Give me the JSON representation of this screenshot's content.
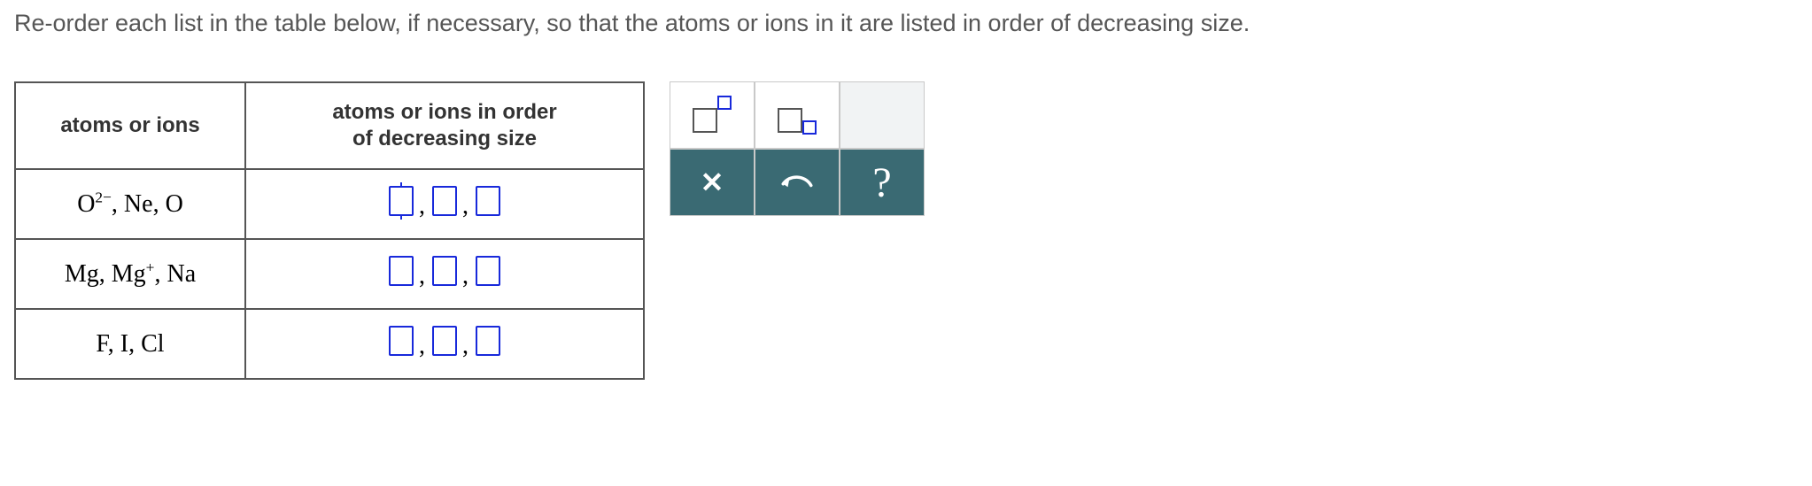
{
  "instruction": "Re-order each list in the table below, if necessary, so that the atoms or ions in it are listed in order of decreasing size.",
  "table": {
    "headers": {
      "col1": "atoms or ions",
      "col2_line1": "atoms or ions in order",
      "col2_line2": "of decreasing size"
    },
    "rows": [
      {
        "species": [
          {
            "base": "O",
            "sup": "2−"
          },
          {
            "base": "Ne"
          },
          {
            "base": "O"
          }
        ],
        "active_slot": 0
      },
      {
        "species": [
          {
            "base": "Mg"
          },
          {
            "base": "Mg",
            "sup": "+"
          },
          {
            "base": "Na"
          }
        ],
        "active_slot": -1
      },
      {
        "species": [
          {
            "base": "F"
          },
          {
            "base": "I"
          },
          {
            "base": "Cl"
          }
        ],
        "active_slot": -1
      }
    ]
  },
  "tools": {
    "superscript": "superscript",
    "subscript": "subscript",
    "clear": "✕",
    "undo": "undo",
    "help": "?"
  }
}
